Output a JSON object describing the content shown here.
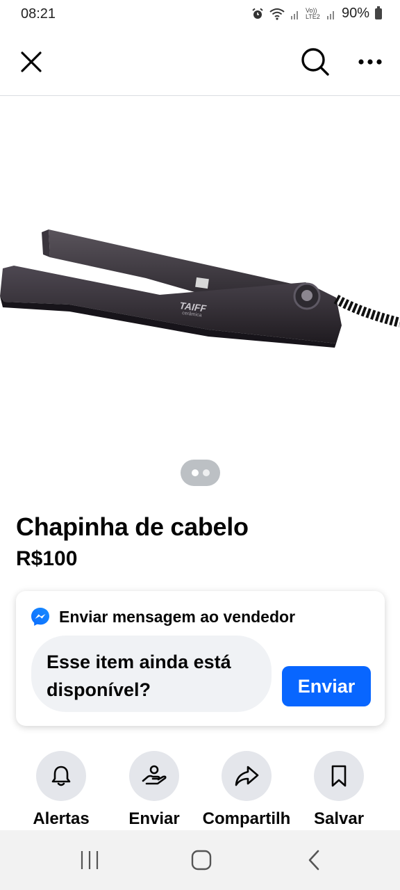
{
  "status_bar": {
    "time": "08:21",
    "network_label": "Vo)) LTE2",
    "battery": "90%",
    "icons": [
      "alarm-icon",
      "wifi-icon",
      "signal-icon",
      "signal-icon",
      "battery-icon"
    ]
  },
  "header": {
    "icons": [
      "close-icon",
      "search-icon",
      "more-icon"
    ]
  },
  "product": {
    "brand_text": "TAIFF",
    "brand_subtext": "cerâmica",
    "title": "Chapinha de cabelo",
    "price": "R$100",
    "photo_count": 2,
    "active_photo": 1
  },
  "message": {
    "heading": "Enviar mensagem ao vendedor",
    "text": "Esse item ainda está disponível?",
    "send_label": "Enviar",
    "accent_color": "#0866ff"
  },
  "actions": [
    {
      "label": "Alertas",
      "icon": "bell-icon"
    },
    {
      "label": "Enviar",
      "icon": "send-hand-icon"
    },
    {
      "label": "Compartilh",
      "icon": "share-icon"
    },
    {
      "label": "Salvar",
      "icon": "bookmark-icon"
    }
  ],
  "nav": {
    "icons": [
      "recent-apps-icon",
      "home-icon",
      "back-icon"
    ]
  }
}
